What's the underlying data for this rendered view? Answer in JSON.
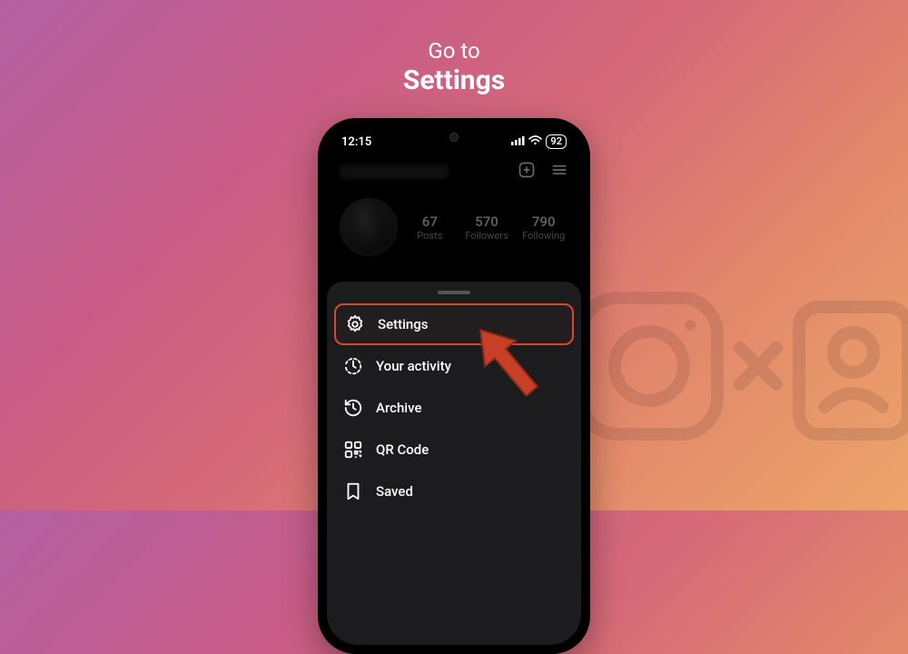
{
  "headline": {
    "sub": "Go to",
    "main": "Settings"
  },
  "status": {
    "time": "12:15",
    "battery": "92"
  },
  "profile": {
    "top_actions": {
      "add": "add-post",
      "menu": "menu"
    },
    "stats": {
      "posts": {
        "value": "67",
        "label": "Posts"
      },
      "followers": {
        "value": "570",
        "label": "Followers"
      },
      "following": {
        "value": "790",
        "label": "Following"
      }
    }
  },
  "sheet": {
    "items": [
      {
        "icon": "settings-icon",
        "label": "Settings",
        "highlighted": true
      },
      {
        "icon": "activity-icon",
        "label": "Your activity",
        "highlighted": false
      },
      {
        "icon": "archive-icon",
        "label": "Archive",
        "highlighted": false
      },
      {
        "icon": "qr-icon",
        "label": "QR Code",
        "highlighted": false
      },
      {
        "icon": "saved-icon",
        "label": "Saved",
        "highlighted": false
      }
    ]
  },
  "colors": {
    "highlight": "#d24a2d",
    "arrow": "#c73f27"
  }
}
